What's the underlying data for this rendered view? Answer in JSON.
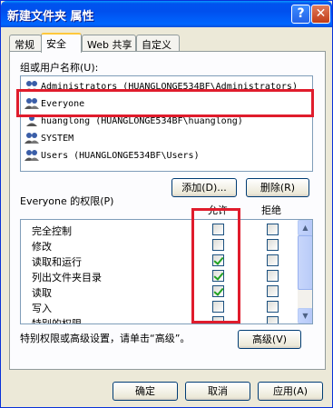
{
  "window": {
    "title": "新建文件夹 属性",
    "help_glyph": "?",
    "close_glyph": "✕"
  },
  "tabs": [
    {
      "label": "常规",
      "active": false
    },
    {
      "label": "安全",
      "active": true
    },
    {
      "label": "Web 共享",
      "active": false
    },
    {
      "label": "自定义",
      "active": false
    }
  ],
  "groups": {
    "label": "组或用户名称(U):",
    "items": [
      {
        "name": "Administrators (HUANGLONGE534BF\\Administrators)",
        "selected": false
      },
      {
        "name": "Everyone",
        "selected": true
      },
      {
        "name": "huanglong (HUANGLONGE534BF\\huanglong)",
        "selected": false
      },
      {
        "name": "SYSTEM",
        "selected": false
      },
      {
        "name": "Users (HUANGLONGE534BF\\Users)",
        "selected": false
      }
    ]
  },
  "buttons": {
    "add": "添加(D)...",
    "remove": "删除(R)",
    "advanced": "高级(V)",
    "ok": "确定",
    "cancel": "取消",
    "apply": "应用(A)"
  },
  "permissions": {
    "label": "Everyone 的权限(P)",
    "allow_header": "允许",
    "deny_header": "拒绝",
    "rows": [
      {
        "name": "完全控制",
        "allow": false,
        "deny": false
      },
      {
        "name": "修改",
        "allow": false,
        "deny": false
      },
      {
        "name": "读取和运行",
        "allow": true,
        "deny": false
      },
      {
        "name": "列出文件夹目录",
        "allow": true,
        "deny": false
      },
      {
        "name": "读取",
        "allow": true,
        "deny": false
      },
      {
        "name": "写入",
        "allow": false,
        "deny": false
      },
      {
        "name": "特别的权限",
        "allow": false,
        "deny": false
      }
    ]
  },
  "special_note": "特别权限或高级设置，请单击“高级”。",
  "colors": {
    "highlight_box": "#e01c2c",
    "title_bar": "#0053ee",
    "dialog_bg": "#ece9d8"
  }
}
